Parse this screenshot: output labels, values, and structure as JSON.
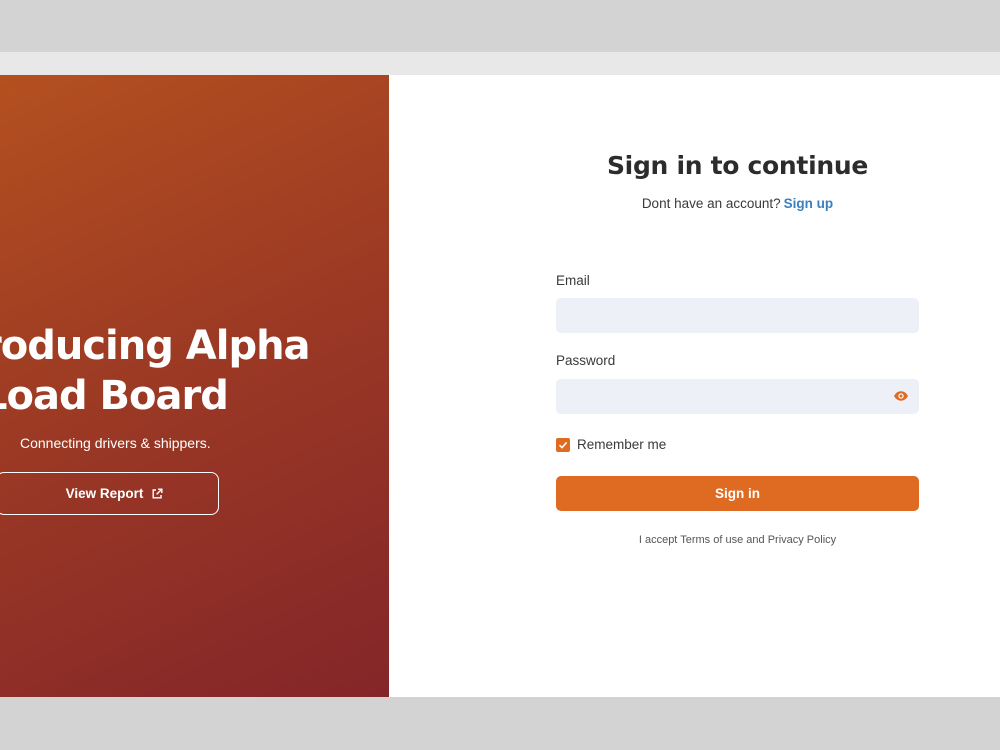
{
  "hero": {
    "title_line1": "roducing Alpha",
    "title_line2": "Load Board",
    "subtitle": "Connecting drivers & shippers.",
    "view_report_label": "View Report",
    "view_report_icon": "external-link-icon",
    "gradient_start": "#b4501f",
    "gradient_end": "#842529"
  },
  "signin": {
    "title": "Sign in to continue",
    "no_account_text": "Dont have an account?",
    "signup_label": "Sign up",
    "email_label": "Email",
    "email_value": "",
    "password_label": "Password",
    "password_value": "",
    "password_toggle_icon": "eye-icon",
    "remember_label": "Remember me",
    "remember_checked": true,
    "submit_label": "Sign in",
    "terms_prefix": "I accept",
    "terms_link": "Terms of use",
    "terms_and": "and",
    "privacy_link": "Privacy Policy",
    "accent_color": "#df6b23",
    "link_color": "#3a7fc1"
  }
}
